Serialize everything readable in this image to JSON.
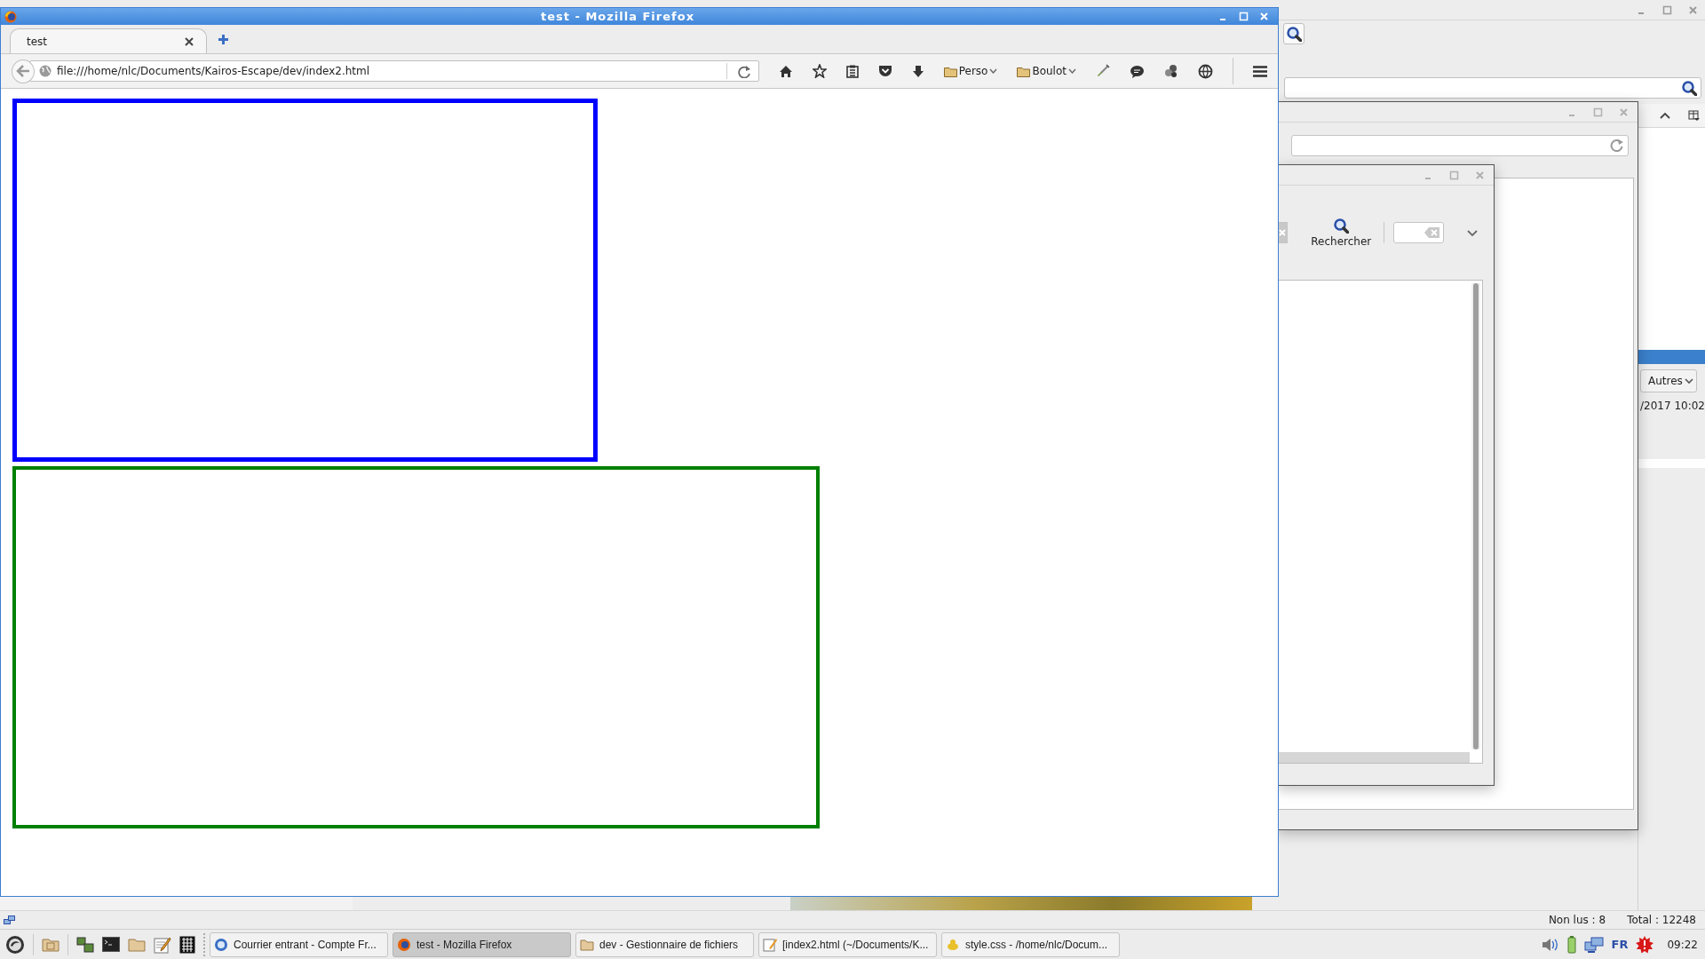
{
  "thunderbird": {
    "message_pane": {
      "filter_button": "Autres",
      "date": "/2017 10:02"
    },
    "status_bar": {
      "unread": "Non lus : 8",
      "total": "Total : 12248"
    }
  },
  "search_dialog": {
    "search_button": "Rechercher"
  },
  "firefox": {
    "title": "test - Mozilla Firefox",
    "tabs": [
      {
        "label": "test",
        "selected": true
      }
    ],
    "url": "file:///home/nlc/Documents/Kairos-Escape/dev/index2.html",
    "bookmark_folders": [
      {
        "label": "Perso"
      },
      {
        "label": "Boulot"
      }
    ],
    "page_boxes": [
      {
        "color": "#0000ff"
      },
      {
        "color": "#008000"
      }
    ]
  },
  "taskbar": {
    "tasks": [
      {
        "label": "Courrier entrant - Compte Fr...",
        "selected": false
      },
      {
        "label": "test - Mozilla Firefox",
        "selected": true
      },
      {
        "label": "dev - Gestionnaire de fichiers",
        "selected": false
      },
      {
        "label": "[index2.html (~/Documents/K...",
        "selected": false
      },
      {
        "label": "style.css - /home/nlc/Docum...",
        "selected": false
      }
    ],
    "keyboard_layout": "FR",
    "clock": "09:22"
  }
}
